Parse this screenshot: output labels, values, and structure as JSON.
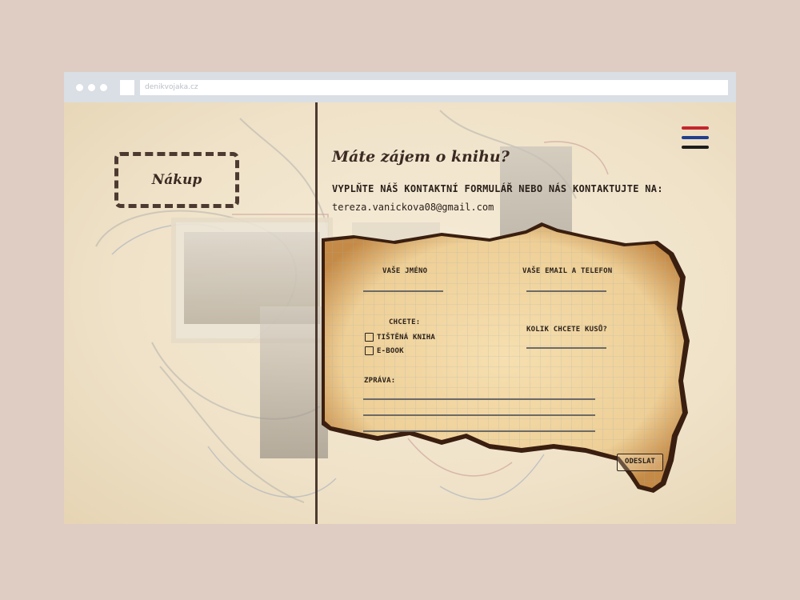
{
  "browser": {
    "url": "denikvojaka.cz"
  },
  "sidebar": {
    "nakup_label": "Nákup"
  },
  "menu": {
    "icon": "hamburger-flag-icon",
    "colors": [
      "#c4262e",
      "#1f3f8f",
      "#1c1c1c"
    ]
  },
  "main": {
    "headline": "Máte zájem o knihu?",
    "subline": "VYPLŇTE NÁŠ KONTAKTNÍ FORMULÁŘ NEBO NÁS KONTAKTUJTE NA:",
    "email": "tereza.vanickova08@gmail.com"
  },
  "form": {
    "name_label": "VAŠE JMÉNO",
    "contact_label": "VAŠE EMAIL A TELEFON",
    "want_label": "CHCETE:",
    "options": [
      "TIŠTĚNÁ KNIHA",
      "E-BOOK"
    ],
    "quantity_label": "KOLIK CHCETE KUSŮ?",
    "message_label": "ZPRÁVA:",
    "submit_label": "ODESLAT"
  },
  "colors": {
    "dark_brown": "#4d3a30",
    "paper": "#f3d9a8",
    "burn": "#3a1f10"
  }
}
